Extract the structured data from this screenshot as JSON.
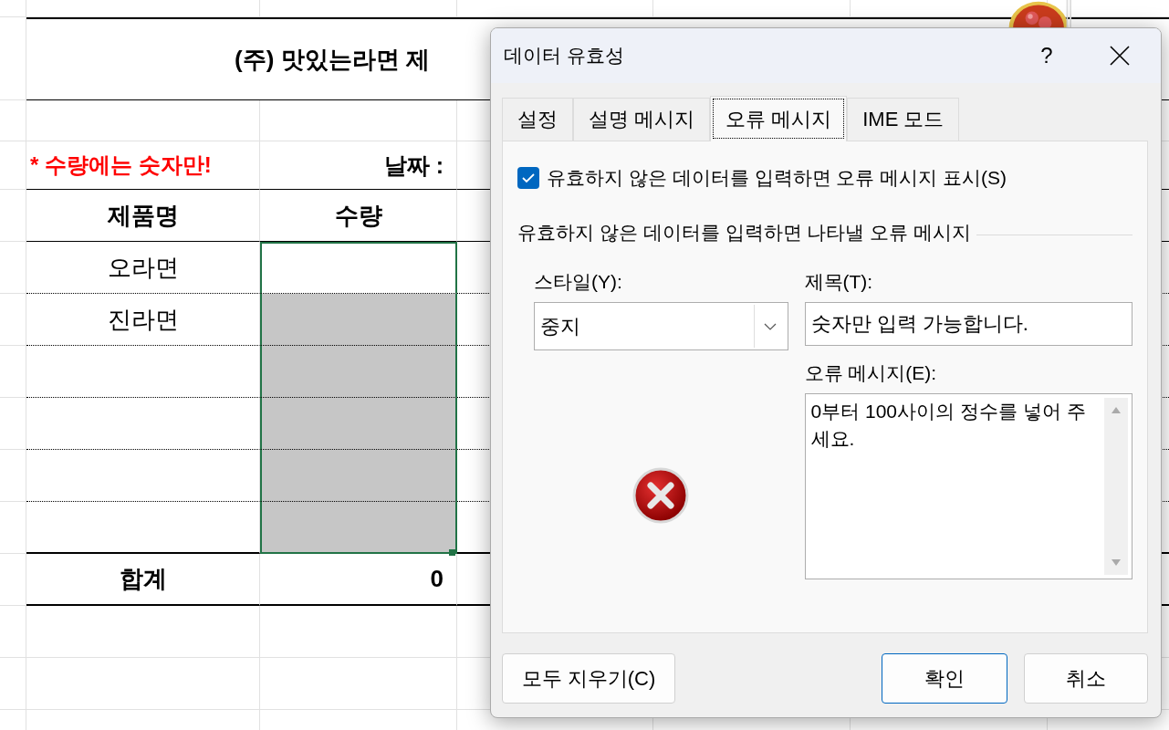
{
  "sheet": {
    "title": "(주) 맛있는라면 제",
    "note": "* 수량에는 숫자만!",
    "date_label": "날짜 :",
    "columns": [
      "제품명",
      "수량"
    ],
    "rows": [
      {
        "product": "오라면",
        "selected": true,
        "active": true
      },
      {
        "product": "진라면",
        "selected": true,
        "active": false
      },
      {
        "selected": true,
        "active": false
      },
      {
        "selected": true,
        "active": false
      },
      {
        "selected": true,
        "active": false
      },
      {
        "selected": true,
        "active": false
      }
    ],
    "total": {
      "label": "합계",
      "value": "0"
    }
  },
  "dialog": {
    "title": "데이터 유효성",
    "help": "?",
    "tabs": [
      {
        "label": "설정",
        "selected": false
      },
      {
        "label": "설명 메시지",
        "selected": false
      },
      {
        "label": "오류 메시지",
        "selected": true
      },
      {
        "label": "IME 모드",
        "selected": false
      }
    ],
    "show_error": {
      "label": "유효하지 않은 데이터를 입력하면 오류 메시지 표시(S)",
      "checked": true
    },
    "group_label": "유효하지 않은 데이터를 입력하면 나타낼 오류 메시지",
    "style": {
      "label": "스타일(Y):",
      "value": "중지"
    },
    "title_field": {
      "label": "제목(T):",
      "value": "숫자만 입력 가능합니다."
    },
    "message_field": {
      "label": "오류 메시지(E):",
      "value": "0부터 100사이의 정수를 넣어 주세요."
    },
    "buttons": [
      {
        "label": "모두 지우기(C)",
        "kind": "secondary"
      },
      {
        "label": "확인",
        "kind": "default"
      },
      {
        "label": "취소",
        "kind": "normal"
      }
    ]
  }
}
